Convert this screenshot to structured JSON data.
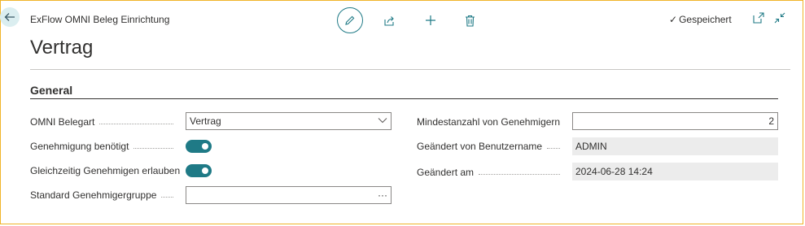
{
  "header": {
    "app_title": "ExFlow OMNI Beleg Einrichtung",
    "saved_status": "Gespeichert",
    "back_icon": "arrow-left-icon",
    "toolbar_icons": [
      "edit-icon",
      "share-icon",
      "add-icon",
      "delete-icon"
    ],
    "window_icons": [
      "open-new-window-icon",
      "collapse-icon"
    ]
  },
  "page": {
    "title": "Vertrag"
  },
  "section": {
    "title": "General"
  },
  "left_fields": [
    {
      "label": "OMNI Belegart",
      "value": "Vertrag",
      "type": "select"
    },
    {
      "label": "Genehmigung benötigt",
      "value": "on",
      "type": "toggle"
    },
    {
      "label": "Gleichzeitig Genehmigen erlauben",
      "value": "on",
      "type": "toggle"
    },
    {
      "label": "Standard Genehmigergruppe",
      "value": "",
      "type": "lookup",
      "button": "···"
    }
  ],
  "right_fields": [
    {
      "label": "Mindestanzahl von Genehmigern",
      "value": "2",
      "type": "number"
    },
    {
      "label": "Geändert von Benutzername",
      "value": "ADMIN",
      "type": "readonly"
    },
    {
      "label": "Geändert am",
      "value": "2024-06-28 14:24",
      "type": "readonly"
    }
  ],
  "colors": {
    "accent": "#1f7a86",
    "frame": "#f0b429"
  }
}
